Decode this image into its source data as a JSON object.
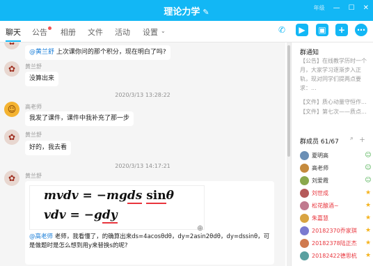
{
  "window": {
    "title": "理论力学",
    "edit_icon": "pencil-icon",
    "blurred_label": "年级",
    "minimize": "—",
    "maximize": "☐",
    "close": "✕"
  },
  "tabs": [
    {
      "label": "聊天",
      "active": true
    },
    {
      "label": "公告",
      "badge": true
    },
    {
      "label": "相册"
    },
    {
      "label": "文件"
    },
    {
      "label": "活动"
    },
    {
      "label": "设置"
    }
  ],
  "toolbar": {
    "phone_icon": "phone-icon",
    "video_icon": "video-icon",
    "screen_icon": "screen-share-icon",
    "add_icon": "add-app-icon",
    "more_icon": "more-icon"
  },
  "messages": {
    "m0": {
      "mention": "@黄兰舒",
      "text": " 上次课你问的那个积分，现在明白了吗?"
    },
    "m1": {
      "sender": "黄兰舒",
      "text": "没算出来"
    },
    "t1": "2020/3/13 13:28:22",
    "m2": {
      "sender": "高老师",
      "text": "我发了课件，课件中我补充了那一步"
    },
    "m3": {
      "sender": "黄兰舒",
      "text": "好的，我去看"
    },
    "t2": "2020/3/13 14:17:21",
    "m4": {
      "sender": "黄兰舒",
      "formula_line1_a": "mvdv = −mg",
      "formula_line1_b": "ds",
      "formula_line1_c": " ",
      "formula_line1_d": "sin",
      "formula_line1_e": "θ",
      "formula_line2_a": "vdv = −g",
      "formula_line2_b": "dy",
      "mention": "@高老师",
      "text": " 老师，我看懂了，的确算出来ds=4acosθdθ，dy=2asin2θdθ，dy=dssinθ，可是做题时是怎么想到用y来替换s的呢?"
    }
  },
  "sidebar": {
    "notice_title": "群通知",
    "notice_body": "【公告】在线教学历时一个月，大家学习逐渐步入正轨，现对同学们提两点要求：...",
    "file1": "【文件】质心动量守恒作...",
    "file2": "【文件】第七次——质点...",
    "members_title": "群成员 61/67",
    "member_search_icon": "search-icon",
    "member_add_icon": "add-member-icon",
    "members": [
      {
        "name": "夏明高",
        "color": "#333333",
        "role": "person-icon"
      },
      {
        "name": "高老师",
        "color": "#333333",
        "role": "person-icon"
      },
      {
        "name": "刘爱霞",
        "color": "#333333",
        "role": "person-icon"
      },
      {
        "name": "刘世成",
        "color": "#e8343c",
        "role": "star-icon"
      },
      {
        "name": "松花酿酒~",
        "color": "#e8343c",
        "role": "star-icon"
      },
      {
        "name": "朱嘉慧",
        "color": "#e8343c",
        "role": "star-icon"
      },
      {
        "name": "20182370乔家琪",
        "color": "#e8343c",
        "role": "star-icon"
      },
      {
        "name": "20182378陆正杰",
        "color": "#e8343c",
        "role": "star-icon"
      },
      {
        "name": "20182422德思杭",
        "color": "#e8343c",
        "role": "star-icon"
      }
    ]
  },
  "colors": {
    "accent": "#12b7f5",
    "red": "#e8343c",
    "link": "#1a7ed8"
  }
}
